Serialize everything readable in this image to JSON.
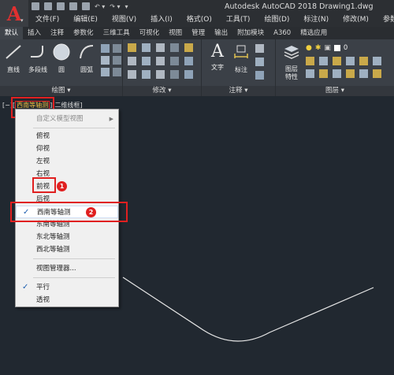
{
  "app": {
    "title": "Autodesk AutoCAD 2018    Drawing1.dwg",
    "logo_letter": "A"
  },
  "menubar": [
    "文件(F)",
    "编辑(E)",
    "视图(V)",
    "插入(I)",
    "格式(O)",
    "工具(T)",
    "绘图(D)",
    "标注(N)",
    "修改(M)",
    "参数(P)"
  ],
  "ribbon_tabs": [
    "默认",
    "插入",
    "注释",
    "参数化",
    "三维工具",
    "可视化",
    "视图",
    "管理",
    "输出",
    "附加模块",
    "A360",
    "精选应用"
  ],
  "ribbon": {
    "draw_panel": {
      "title": "绘图 ▾",
      "tools": [
        "直线",
        "多段线",
        "圆",
        "圆弧"
      ]
    },
    "modify_panel": {
      "title": "修改 ▾"
    },
    "annotation_panel": {
      "title": "注释 ▾",
      "tools": [
        "文字",
        "标注"
      ]
    },
    "layer_panel": {
      "title": "图层 ▾",
      "tools": [
        "图层\n特性"
      ],
      "layer_value": "0"
    }
  },
  "viewport": {
    "label_prefix": "[−][",
    "label_view": "西南等轴测",
    "label_suffix": "][二维线框]"
  },
  "context_menu": {
    "items": [
      {
        "label": "自定义模型视图",
        "disabled": true,
        "submenu": true
      },
      {
        "label": "俯视"
      },
      {
        "label": "仰视"
      },
      {
        "label": "左视"
      },
      {
        "label": "右视"
      },
      {
        "label": "前视"
      },
      {
        "label": "后视"
      },
      {
        "label": "西南等轴测",
        "checked": true
      },
      {
        "label": "东南等轴测"
      },
      {
        "label": "东北等轴测"
      },
      {
        "label": "西北等轴测"
      },
      {
        "label": "视图管理器..."
      },
      {
        "label": "平行",
        "checked": true
      },
      {
        "label": "透视"
      }
    ]
  },
  "annotations": {
    "badge1": "1",
    "badge2": "2"
  },
  "colors": {
    "accent": "#e02020",
    "highlight_text": "#f0c040",
    "canvas": "#212830"
  }
}
